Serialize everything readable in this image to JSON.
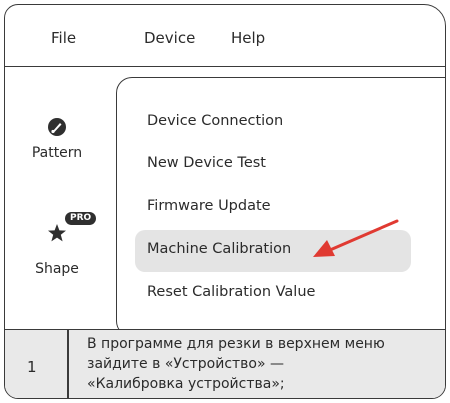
{
  "menubar": {
    "file_label": "File",
    "device_label": "Device",
    "help_label": "Help"
  },
  "sidebar": {
    "pattern_label": "Pattern",
    "shape_label": "Shape",
    "pro_badge": "PRO",
    "pattern_icon": "palette-icon",
    "shape_icon": "star-icon"
  },
  "dropdown": {
    "items": [
      {
        "label": "Device Connection"
      },
      {
        "label": "New Device Test"
      },
      {
        "label": "Firmware Update"
      },
      {
        "label": "Machine Calibration"
      },
      {
        "label": "Reset Calibration Value"
      }
    ],
    "highlighted_index": 3
  },
  "annotation": {
    "arrow_color": "#e03a32"
  },
  "instruction": {
    "step_number": "1",
    "line1": "В программе для резки в верхнем меню",
    "line2": "зайдите в «Устройство» —",
    "line3": "«Калибровка устройства»;"
  },
  "colors": {
    "highlight_bg": "#e4e4e4",
    "footer_bg": "#e9e9e9",
    "border": "#3a3a3a"
  }
}
